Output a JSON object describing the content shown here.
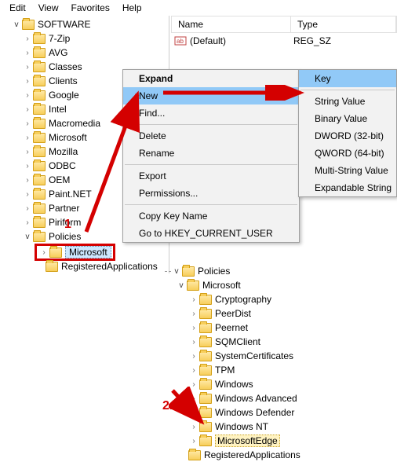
{
  "menubar": {
    "edit": "Edit",
    "view": "View",
    "favorites": "Favorites",
    "help": "Help"
  },
  "columns": {
    "name": "Name",
    "type": "Type"
  },
  "list": {
    "default_name": "(Default)",
    "default_type": "REG_SZ"
  },
  "tree_root": "SOFTWARE",
  "tree_items": [
    "7-Zip",
    "AVG",
    "Classes",
    "Clients",
    "Google",
    "Intel",
    "Macromedia",
    "Microsoft",
    "Mozilla",
    "ODBC",
    "OEM",
    "Paint.NET",
    "Partner",
    "Piriform",
    "Policies"
  ],
  "selected_child": "Microsoft",
  "after_selected": "RegisteredApplications",
  "context_menu": {
    "expand": "Expand",
    "new": "New",
    "find": "Find...",
    "delete": "Delete",
    "rename": "Rename",
    "export": "Export",
    "permissions": "Permissions...",
    "copykey": "Copy Key Name",
    "goto": "Go to HKEY_CURRENT_USER"
  },
  "submenu": {
    "key": "Key",
    "string": "String Value",
    "binary": "Binary Value",
    "dword": "DWORD (32-bit)",
    "qword": "QWORD (64-bit)",
    "multi": "Multi-String Value",
    "expand": "Expandable String"
  },
  "lower": {
    "policies": "Policies",
    "microsoft": "Microsoft",
    "children": [
      "Cryptography",
      "PeerDist",
      "Peernet",
      "SQMClient",
      "SystemCertificates",
      "TPM",
      "Windows",
      "Windows Advanced",
      "Windows Defender",
      "Windows NT"
    ],
    "target": "MicrosoftEdge",
    "registered": "RegisteredApplications"
  },
  "annotations": {
    "a1": "1",
    "a2": "2."
  }
}
